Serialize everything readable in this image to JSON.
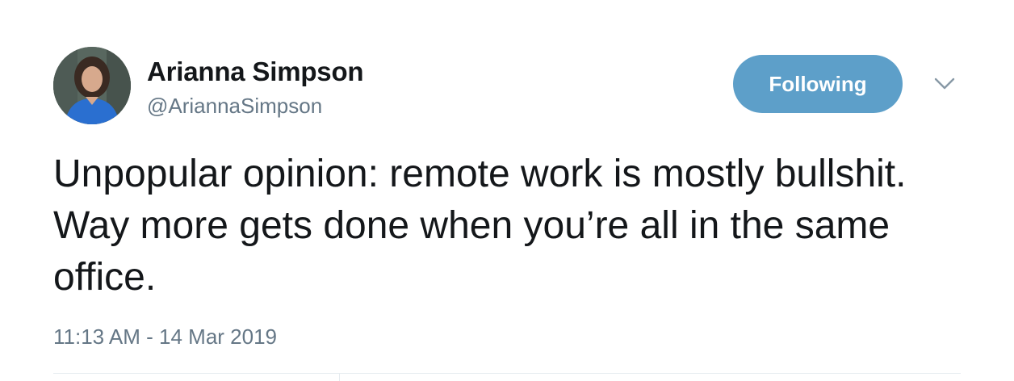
{
  "user": {
    "display_name": "Arianna Simpson",
    "handle": "@AriannaSimpson",
    "avatar_icon": "profile-photo"
  },
  "actions": {
    "follow_label": "Following",
    "follow_color": "#5d9fc9",
    "menu_icon": "chevron-down-icon"
  },
  "tweet": {
    "text": "Unpopular opinion: remote work is mostly bullshit. Way more gets done when you’re all in the same office.",
    "timestamp": "11:13 AM - 14 Mar 2019"
  },
  "colors": {
    "text_primary": "#14171a",
    "text_secondary": "#657786",
    "divider": "#e6ecf0"
  }
}
